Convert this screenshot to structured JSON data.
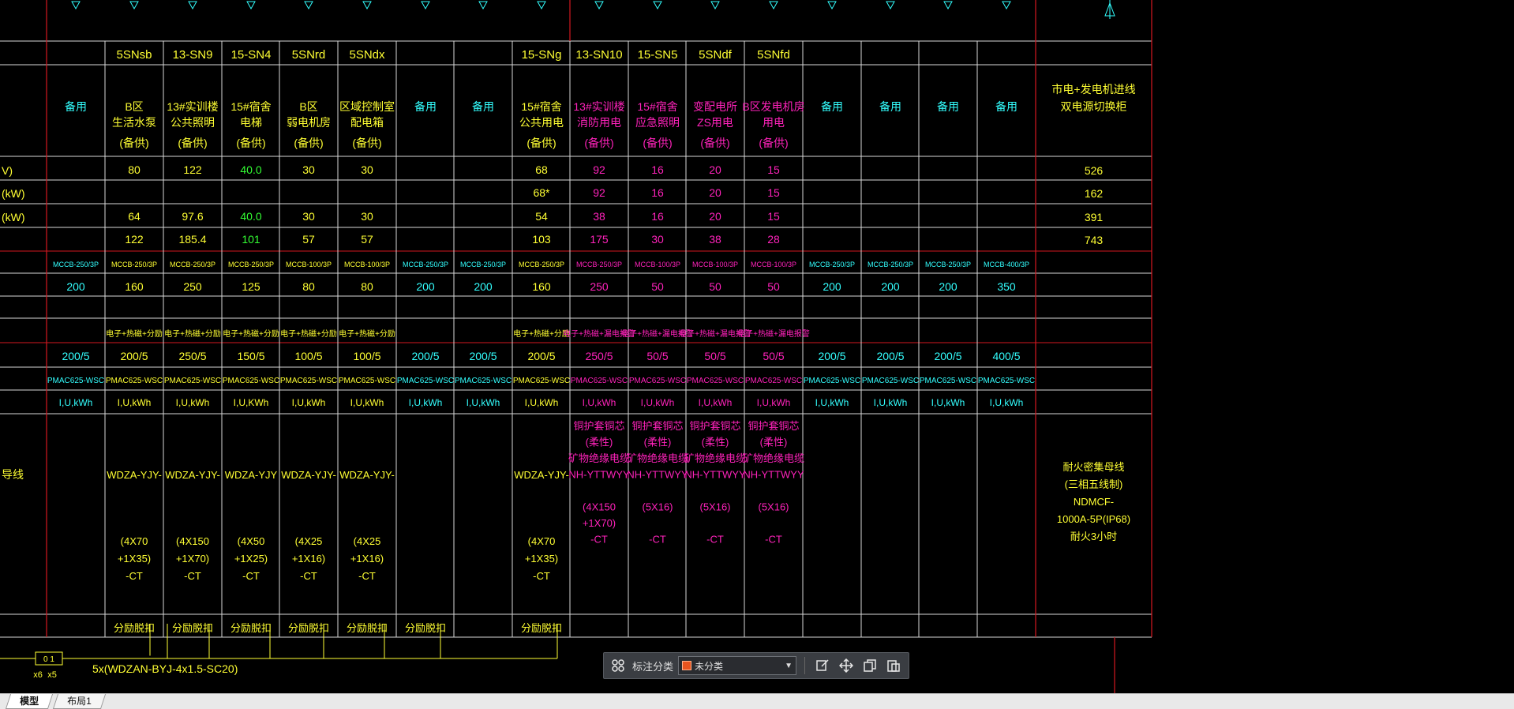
{
  "colors": {
    "yellow": "#ffff33",
    "cyan": "#33ffff",
    "magenta": "#ff22bb",
    "green": "#33ff33",
    "grid_white": "#d8d8d8",
    "border_red": "#d41820"
  },
  "row_labels": [
    "V)",
    "(kW)",
    "(kW)",
    "导线"
  ],
  "columns": [
    {
      "code": "",
      "usage": [
        "备用"
      ],
      "p1": "",
      "p2": "",
      "p3": "",
      "p4": "",
      "breaker": "MCCB-250/3P",
      "current": "200",
      "misc": "",
      "ct": "200/5",
      "meter": "PMAC625-WSC",
      "measure": "I,U,kWh",
      "cable": [],
      "install": "",
      "color": "cyan"
    },
    {
      "code": "5SNsb",
      "usage": [
        "B区",
        "生活水泵",
        "(备供)"
      ],
      "p1": "80",
      "p2": "",
      "p3": "64",
      "p4": "122",
      "breaker": "MCCB-250/3P",
      "current": "160",
      "misc": "电子+热磁+分励",
      "ct": "200/5",
      "meter": "PMAC625-WSC",
      "measure": "I,U,kWh",
      "cable": [
        "WDZA-YJY-",
        "",
        "(4X70",
        "+1X35)",
        "-CT"
      ],
      "install": "分励脱扣",
      "color": "yellow"
    },
    {
      "code": "13-SN9",
      "usage": [
        "13#实训楼",
        "公共照明",
        "(备供)"
      ],
      "p1": "122",
      "p2": "",
      "p3": "97.6",
      "p4": "185.4",
      "breaker": "MCCB-250/3P",
      "current": "250",
      "misc": "电子+热磁+分励",
      "ct": "250/5",
      "meter": "PMAC625-WSC",
      "measure": "I,U,kWh",
      "cable": [
        "WDZA-YJY-",
        "",
        "(4X150",
        "+1X70)",
        "-CT"
      ],
      "install": "分励脱扣",
      "color": "yellow"
    },
    {
      "code": "15-SN4",
      "usage": [
        "15#宿舍",
        "电梯",
        "(备供)"
      ],
      "p1": "40.0",
      "p2": "",
      "p3": "40.0",
      "p4": "101",
      "breaker": "MCCB-250/3P",
      "current": "125",
      "misc": "电子+热磁+分励",
      "ct": "150/5",
      "meter": "PMAC625-WSC",
      "measure": "I,U,KWh",
      "cable": [
        "WDZA-YJY",
        "",
        "(4X50",
        "+1X25)",
        "-CT"
      ],
      "install": "分励脱扣",
      "color": "yellow"
    },
    {
      "code": "5SNrd",
      "usage": [
        "B区",
        "弱电机房",
        "(备供)"
      ],
      "p1": "30",
      "p2": "",
      "p3": "30",
      "p4": "57",
      "breaker": "MCCB-100/3P",
      "current": "80",
      "misc": "电子+热磁+分励",
      "ct": "100/5",
      "meter": "PMAC625-WSC",
      "measure": "I,U,kWh",
      "cable": [
        "WDZA-YJY-",
        "",
        "(4X25",
        "+1X16)",
        "-CT"
      ],
      "install": "分励脱扣",
      "color": "yellow"
    },
    {
      "code": "5SNdx",
      "usage": [
        "区域控制室",
        "配电箱",
        "(备供)"
      ],
      "p1": "30",
      "p2": "",
      "p3": "30",
      "p4": "57",
      "breaker": "MCCB-100/3P",
      "current": "80",
      "misc": "电子+热磁+分励",
      "ct": "100/5",
      "meter": "PMAC625-WSC",
      "measure": "I,U,kWh",
      "cable": [
        "WDZA-YJY-",
        "",
        "(4X25",
        "+1X16)",
        "-CT"
      ],
      "install": "分励脱扣",
      "color": "yellow"
    },
    {
      "code": "",
      "usage": [
        "备用"
      ],
      "p1": "",
      "p2": "",
      "p3": "",
      "p4": "",
      "breaker": "MCCB-250/3P",
      "current": "200",
      "misc": "",
      "ct": "200/5",
      "meter": "PMAC625-WSC",
      "measure": "I,U,kWh",
      "cable": [],
      "install": "分励脱扣",
      "color": "cyan"
    },
    {
      "code": "",
      "usage": [
        "备用"
      ],
      "p1": "",
      "p2": "",
      "p3": "",
      "p4": "",
      "breaker": "MCCB-250/3P",
      "current": "200",
      "misc": "",
      "ct": "200/5",
      "meter": "PMAC625-WSC",
      "measure": "I,U,kWh",
      "cable": [],
      "install": "",
      "color": "cyan"
    },
    {
      "code": "15-SNg",
      "usage": [
        "15#宿舍",
        "公共用电",
        "(备供)"
      ],
      "p1": "68",
      "p2": "68*",
      "p3": "54",
      "p4": "103",
      "breaker": "MCCB-250/3P",
      "current": "160",
      "misc": "电子+热磁+分励",
      "ct": "200/5",
      "meter": "PMAC625-WSC",
      "measure": "I,U,kWh",
      "cable": [
        "WDZA-YJY-",
        "",
        "(4X70",
        "+1X35)",
        "-CT"
      ],
      "install": "分励脱扣",
      "color": "yellow"
    },
    {
      "code": "13-SN10",
      "usage": [
        "13#实训楼",
        "消防用电",
        "(备供)"
      ],
      "p1": "92",
      "p2": "92",
      "p3": "38",
      "p4": "175",
      "breaker": "MCCB-250/3P",
      "current": "250",
      "misc": "电子+热磁+漏电报警",
      "ct": "250/5",
      "meter": "PMAC625-WSC",
      "measure": "I,U,kWh",
      "cable": [
        "铜护套铜芯",
        "(柔性)",
        "矿物绝缘电缆",
        "NH-YTTWYY",
        "",
        "(4X150",
        "+1X70)",
        "-CT"
      ],
      "install": "",
      "color": "magenta"
    },
    {
      "code": "15-SN5",
      "usage": [
        "15#宿舍",
        "应急照明",
        "(备供)"
      ],
      "p1": "16",
      "p2": "16",
      "p3": "16",
      "p4": "30",
      "breaker": "MCCB-100/3P",
      "current": "50",
      "misc": "电子+热磁+漏电报警",
      "ct": "50/5",
      "meter": "PMAC625-WSC",
      "measure": "I,U,kWh",
      "cable": [
        "铜护套铜芯",
        "(柔性)",
        "矿物绝缘电缆",
        "NH-YTTWYY",
        "",
        "(5X16)",
        "",
        "-CT"
      ],
      "install": "",
      "color": "magenta"
    },
    {
      "code": "5SNdf",
      "usage": [
        "变配电所",
        "ZS用电",
        "(备供)"
      ],
      "p1": "20",
      "p2": "20",
      "p3": "20",
      "p4": "38",
      "breaker": "MCCB-100/3P",
      "current": "50",
      "misc": "电子+热磁+漏电报警",
      "ct": "50/5",
      "meter": "PMAC625-WSC",
      "measure": "I,U,kWh",
      "cable": [
        "铜护套铜芯",
        "(柔性)",
        "矿物绝缘电缆",
        "NH-YTTWYY",
        "",
        "(5X16)",
        "",
        "-CT"
      ],
      "install": "",
      "color": "magenta"
    },
    {
      "code": "5SNfd",
      "usage": [
        "B区发电机房",
        "用电",
        "(备供)"
      ],
      "p1": "15",
      "p2": "15",
      "p3": "15",
      "p4": "28",
      "breaker": "MCCB-100/3P",
      "current": "50",
      "misc": "电子+热磁+漏电报警",
      "ct": "50/5",
      "meter": "PMAC625-WSC",
      "measure": "I,U,kWh",
      "cable": [
        "铜护套铜芯",
        "(柔性)",
        "矿物绝缘电缆",
        "NH-YTTWYY",
        "",
        "(5X16)",
        "",
        "-CT"
      ],
      "install": "",
      "color": "magenta"
    },
    {
      "code": "",
      "usage": [
        "备用"
      ],
      "p1": "",
      "p2": "",
      "p3": "",
      "p4": "",
      "breaker": "MCCB-250/3P",
      "current": "200",
      "misc": "",
      "ct": "200/5",
      "meter": "PMAC625-WSC",
      "measure": "I,U,kWh",
      "cable": [],
      "install": "",
      "color": "cyan"
    },
    {
      "code": "",
      "usage": [
        "备用"
      ],
      "p1": "",
      "p2": "",
      "p3": "",
      "p4": "",
      "breaker": "MCCB-250/3P",
      "current": "200",
      "misc": "",
      "ct": "200/5",
      "meter": "PMAC625-WSC",
      "measure": "I,U,kWh",
      "cable": [],
      "install": "",
      "color": "cyan"
    },
    {
      "code": "",
      "usage": [
        "备用"
      ],
      "p1": "",
      "p2": "",
      "p3": "",
      "p4": "",
      "breaker": "MCCB-250/3P",
      "current": "200",
      "misc": "",
      "ct": "200/5",
      "meter": "PMAC625-WSC",
      "measure": "I,U,kWh",
      "cable": [],
      "install": "",
      "color": "cyan"
    },
    {
      "code": "",
      "usage": [
        "备用"
      ],
      "p1": "",
      "p2": "",
      "p3": "",
      "p4": "",
      "breaker": "MCCB-400/3P",
      "current": "350",
      "misc": "",
      "ct": "400/5",
      "meter": "PMAC625-WSC",
      "measure": "I,U,kWh",
      "cable": [],
      "install": "",
      "color": "cyan"
    }
  ],
  "summary": {
    "usage": [
      "市电+发电机进线",
      "双电源切换柜"
    ],
    "p1": "526",
    "p2": "162",
    "p3": "391",
    "p4": "743",
    "cable": [
      "耐火密集母线",
      "(三相五线制)",
      "NDMCF-",
      "1000A-5P(IP68)",
      "耐火3小时"
    ]
  },
  "bottom": {
    "feeder_text": "5x(WDZAN-BYJ-4x1.5-SC20)",
    "switch_label": "0 1",
    "terminal_labels": [
      "x6",
      "x5"
    ]
  },
  "toolbar": {
    "label": "标注分类",
    "select_value": "未分类"
  },
  "tabs": [
    "模型",
    "布局1"
  ]
}
